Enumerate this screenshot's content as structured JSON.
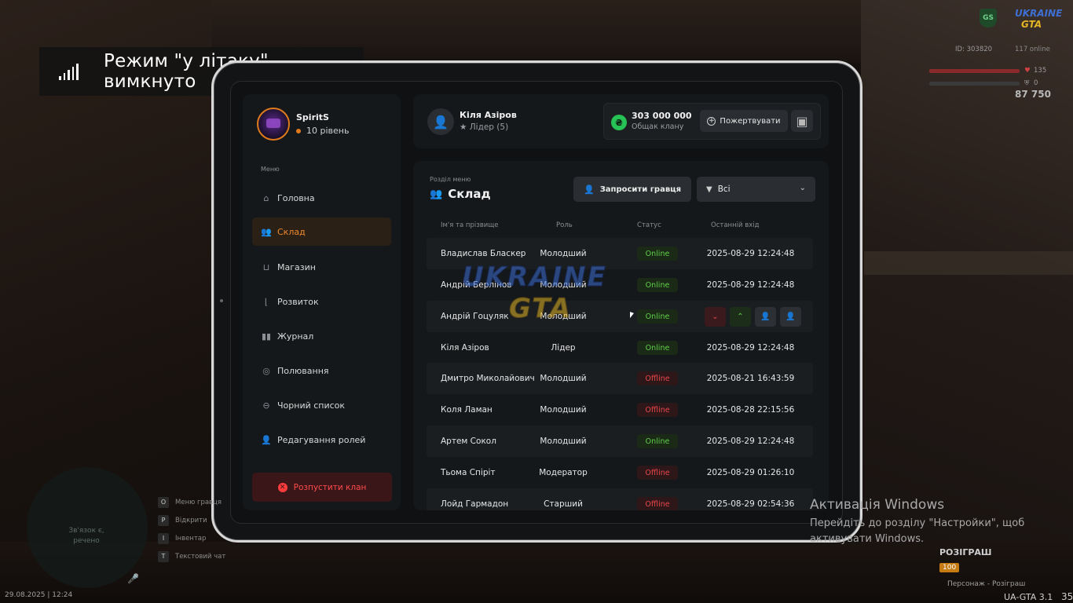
{
  "toast": {
    "text": "Режим \"у літаку\" вимкнуто"
  },
  "sidebar": {
    "profile": {
      "name": "SpiritS",
      "level": "10 рівень"
    },
    "menu_caption": "Меню",
    "items": [
      {
        "label": "Головна",
        "icon": "home-icon"
      },
      {
        "label": "Склад",
        "icon": "users-icon",
        "active": true
      },
      {
        "label": "Магазин",
        "icon": "basket-icon"
      },
      {
        "label": "Розвиток",
        "icon": "chart-icon"
      },
      {
        "label": "Журнал",
        "icon": "book-icon"
      },
      {
        "label": "Полювання",
        "icon": "target-icon"
      },
      {
        "label": "Чорний список",
        "icon": "block-icon"
      },
      {
        "label": "Редагування ролей",
        "icon": "user-edit-icon"
      }
    ],
    "disband_label": "Розпустити клан"
  },
  "header": {
    "leader_name": "Кіля Азіров",
    "leader_role": "Лідер (5)",
    "bank_amount": "303 000 000",
    "bank_label": "Общак клану",
    "donate_label": "Пожертвувати"
  },
  "main": {
    "section_caption": "Розділ меню",
    "section_title": "Склад",
    "invite_label": "Запросити гравця",
    "filter_value": "Всі",
    "columns": [
      "Ім'я та прізвище",
      "Роль",
      "Статус",
      "Останній вхід"
    ],
    "rows": [
      {
        "name": "Владислав Бласкер",
        "role": "Молодший",
        "status": "Online",
        "last": "2025-08-29 12:24:48"
      },
      {
        "name": "Андрій Берлінов",
        "role": "Молодший",
        "status": "Online",
        "last": "2025-08-29 12:24:48"
      },
      {
        "name": "Андрій Гоцуляк",
        "role": "Молодший",
        "status": "Online",
        "last": "",
        "actions": true
      },
      {
        "name": "Кіля Азіров",
        "role": "Лідер",
        "status": "Online",
        "last": "2025-08-29 12:24:48"
      },
      {
        "name": "Дмитро Миколайович",
        "role": "Молодший",
        "status": "Offline",
        "last": "2025-08-21 16:43:59"
      },
      {
        "name": "Коля Ламан",
        "role": "Молодший",
        "status": "Offline",
        "last": "2025-08-28 22:15:56"
      },
      {
        "name": "Артем Сокол",
        "role": "Молодший",
        "status": "Online",
        "last": "2025-08-29 12:24:48"
      },
      {
        "name": "Тьома Спіріт",
        "role": "Модератор",
        "status": "Offline",
        "last": "2025-08-29 01:26:10"
      },
      {
        "name": "Лойд Гармадон",
        "role": "Старший",
        "status": "Offline",
        "last": "2025-08-29 02:54:36"
      }
    ]
  },
  "watermark": {
    "line1": "UKRAINE",
    "line2": "GTA"
  },
  "hud": {
    "logo1": "UKRAINE",
    "logo2": "GTA",
    "shield": "GS",
    "id_text": "ID: 303820",
    "online_text": "117 online",
    "health": "135",
    "armor": "0",
    "money": "87 750"
  },
  "activation": {
    "title": "Активація Windows",
    "subtitle": "Перейдіть до розділу \"Настройки\", щоб активувати Windows."
  },
  "voice": {
    "text": "Зв'язок є, речено"
  },
  "hotkeys": [
    {
      "key": "O",
      "label": "Меню гравця"
    },
    {
      "key": "P",
      "label": "Відкрити"
    },
    {
      "key": "I",
      "label": "Інвентар"
    },
    {
      "key": "T",
      "label": "Текстовий чат"
    }
  ],
  "datetime": "29.08.2025 | 12:24",
  "version": "UA-GTA 3.1",
  "fps": "35",
  "raffle": {
    "title": "РОЗІГРАШ",
    "badge": "100",
    "link": "Персонаж - Розіграш"
  },
  "colors": {
    "accent": "#f08a2a",
    "online": "#5fd04a",
    "offline": "#e8474c",
    "money": "#27c256"
  }
}
